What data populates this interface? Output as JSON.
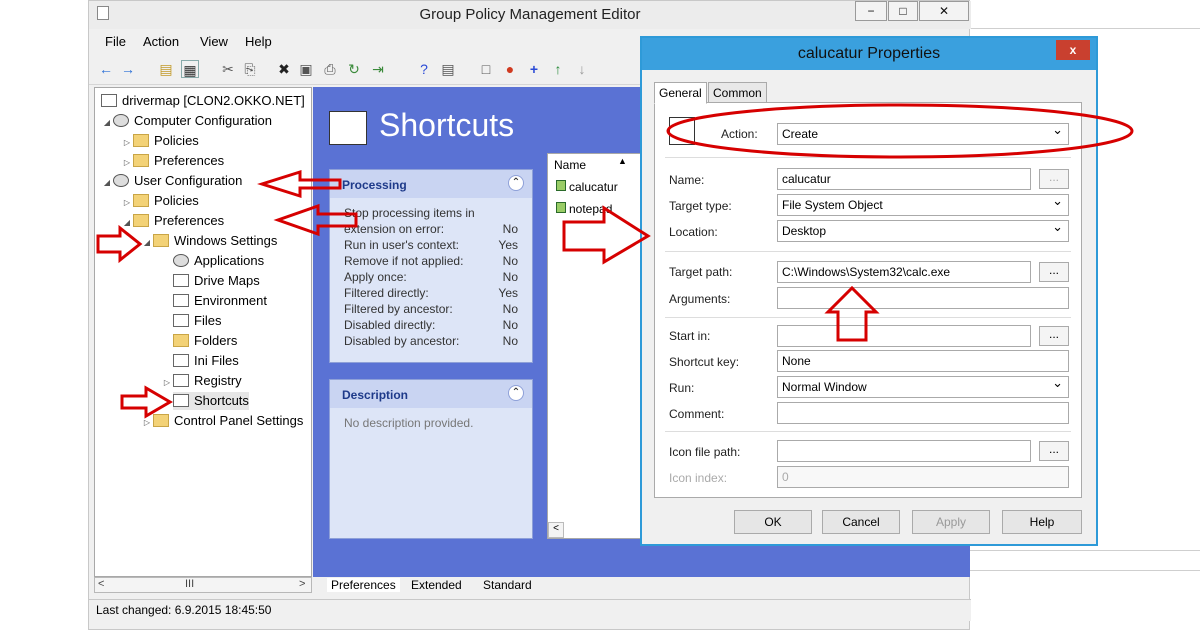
{
  "window": {
    "title": "Group Policy Management Editor",
    "min": "−",
    "max": "□",
    "close": "✕"
  },
  "menu": [
    "File",
    "Action",
    "View",
    "Help"
  ],
  "tree": {
    "root": "drivermap [CLON2.OKKO.NET]",
    "computer_configuration": "Computer Configuration",
    "policies1": "Policies",
    "preferences1": "Preferences",
    "user_configuration": "User Configuration",
    "policies2": "Policies",
    "preferences2": "Preferences",
    "windows_settings": "Windows Settings",
    "applications": "Applications",
    "drive_maps": "Drive Maps",
    "environment": "Environment",
    "files": "Files",
    "folders": "Folders",
    "ini_files": "Ini Files",
    "registry": "Registry",
    "shortcuts": "Shortcuts",
    "control_panel": "Control Panel Settings"
  },
  "hscroll": {
    "left": "<",
    "thumb": "III",
    "right": ">"
  },
  "main": {
    "title": "Shortcuts",
    "processing": {
      "title": "Processing",
      "rows": [
        {
          "k": "Stop processing items in",
          "v": ""
        },
        {
          "k": "extension on error:",
          "v": "No"
        },
        {
          "k": "Run in user's context:",
          "v": "Yes"
        },
        {
          "k": "Remove if not applied:",
          "v": "No"
        },
        {
          "k": "Apply once:",
          "v": "No"
        },
        {
          "k": "Filtered directly:",
          "v": "Yes"
        },
        {
          "k": "Filtered by ancestor:",
          "v": "No"
        },
        {
          "k": "Disabled directly:",
          "v": "No"
        },
        {
          "k": "Disabled by ancestor:",
          "v": "No"
        }
      ]
    },
    "description": {
      "title": "Description",
      "text": "No description provided."
    },
    "list": {
      "header": "Name",
      "items": [
        "calucatur",
        "notepad"
      ]
    },
    "tabs": [
      "Preferences",
      "Extended",
      "Standard"
    ]
  },
  "status": "Last changed: 6.9.2015 18:45:50",
  "dialog": {
    "title": "calucatur Properties",
    "close": "x",
    "tabs": [
      "General",
      "Common"
    ],
    "action_label": "Action:",
    "action_value": "Create",
    "name_label": "Name:",
    "name_value": "calucatur",
    "target_type_label": "Target type:",
    "target_type_value": "File System Object",
    "location_label": "Location:",
    "location_value": "Desktop",
    "target_path_label": "Target path:",
    "target_path_value": "C:\\Windows\\System32\\calc.exe",
    "arguments_label": "Arguments:",
    "start_in_label": "Start in:",
    "shortcut_key_label": "Shortcut key:",
    "shortcut_key_value": "None",
    "run_label": "Run:",
    "run_value": "Normal Window",
    "comment_label": "Comment:",
    "icon_path_label": "Icon file path:",
    "icon_index_label": "Icon index:",
    "icon_index_value": "0",
    "browse": "...",
    "buttons": {
      "ok": "OK",
      "cancel": "Cancel",
      "apply": "Apply",
      "help": "Help"
    }
  },
  "colors": {
    "main_bg": "#5a72d4",
    "dialog_title": "#3aa0de",
    "annotation": "#d60000"
  }
}
